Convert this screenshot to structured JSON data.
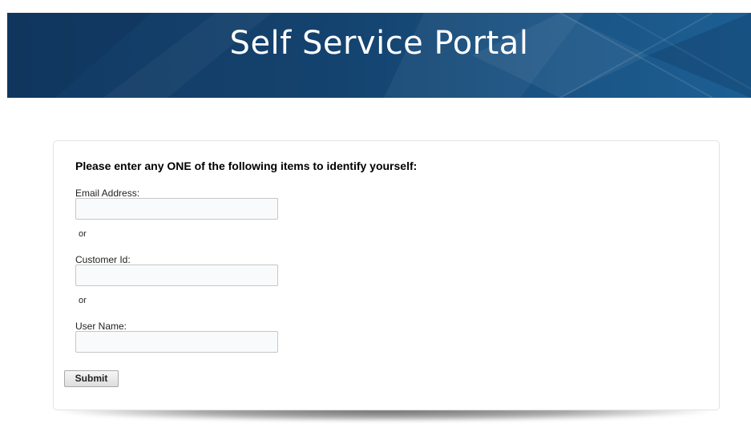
{
  "header": {
    "title": "Self Service Portal"
  },
  "form": {
    "instructions": "Please enter any ONE of the following items to identify yourself:",
    "or_label": "or",
    "email": {
      "label": "Email Address:",
      "value": ""
    },
    "customer_id": {
      "label": "Customer Id:",
      "value": ""
    },
    "user_name": {
      "label": "User Name:",
      "value": ""
    },
    "submit_label": "Submit"
  },
  "colors": {
    "banner_dark": "#123a63",
    "banner_light": "#1d5f93",
    "page_background": "#ffffff"
  }
}
